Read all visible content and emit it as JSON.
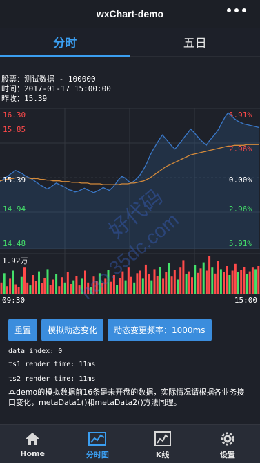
{
  "navbar": {
    "title": "wxChart-demo",
    "more_icon": "more-dots-icon"
  },
  "tabs": [
    {
      "label": "分时",
      "active": true
    },
    {
      "label": "五日",
      "active": false
    }
  ],
  "stock_info": {
    "name_line": "股票：测试数据 - 100000",
    "time_line": "时间：2017-01-17 15:00:00",
    "prev_close_line": "昨收：15.39"
  },
  "chart_data": {
    "type": "line",
    "price_labels": [
      "16.30",
      "15.85",
      "15.39",
      "14.94",
      "14.48"
    ],
    "percent_labels": [
      "5.91%",
      "2.96%",
      "0.00%",
      "2.96%",
      "5.91%"
    ],
    "ylim": [
      14.48,
      16.3
    ],
    "prev_close": 15.39,
    "volume_max_label": "1.92万",
    "x_labels": [
      "09:30",
      "15:00"
    ],
    "colors": {
      "up": "#ff4a4a",
      "down": "#44e06a",
      "price_line": "#3a78c8",
      "avg_line": "#d48a3a"
    },
    "price_series": [
      15.35,
      15.38,
      15.41,
      15.44,
      15.47,
      15.5,
      15.48,
      15.46,
      15.43,
      15.41,
      15.39,
      15.36,
      15.33,
      15.3,
      15.28,
      15.25,
      15.27,
      15.3,
      15.33,
      15.31,
      15.29,
      15.27,
      15.24,
      15.23,
      15.21,
      15.22,
      15.24,
      15.26,
      15.24,
      15.22,
      15.2,
      15.22,
      15.24,
      15.27,
      15.25,
      15.23,
      15.27,
      15.32,
      15.38,
      15.42,
      15.4,
      15.36,
      15.33,
      15.36,
      15.4,
      15.45,
      15.52,
      15.6,
      15.7,
      15.78,
      15.85,
      15.92,
      15.98,
      15.93,
      15.88,
      15.83,
      15.79,
      15.84,
      15.89,
      15.95,
      16.0,
      16.06,
      16.02,
      15.97,
      15.92,
      15.88,
      15.84,
      15.9,
      15.95,
      16.0,
      16.06,
      16.14,
      16.22,
      16.28,
      16.24,
      16.2,
      16.17,
      16.15,
      16.13,
      16.12,
      16.11,
      16.1,
      16.09,
      16.08
    ],
    "avg_series": [
      15.36,
      15.37,
      15.38,
      15.39,
      15.39,
      15.4,
      15.4,
      15.4,
      15.4,
      15.4,
      15.39,
      15.39,
      15.39,
      15.38,
      15.38,
      15.37,
      15.37,
      15.36,
      15.36,
      15.36,
      15.35,
      15.35,
      15.35,
      15.34,
      15.34,
      15.34,
      15.33,
      15.33,
      15.33,
      15.32,
      15.32,
      15.32,
      15.32,
      15.31,
      15.31,
      15.31,
      15.31,
      15.31,
      15.31,
      15.32,
      15.32,
      15.32,
      15.33,
      15.33,
      15.34,
      15.35,
      15.36,
      15.38,
      15.4,
      15.43,
      15.46,
      15.49,
      15.52,
      15.55,
      15.57,
      15.59,
      15.61,
      15.63,
      15.65,
      15.67,
      15.69,
      15.71,
      15.72,
      15.73,
      15.74,
      15.75,
      15.76,
      15.77,
      15.78,
      15.79,
      15.8,
      15.81,
      15.82,
      15.83,
      15.83,
      15.84,
      15.84,
      15.84,
      15.84,
      15.85,
      15.85,
      15.85,
      15.85,
      15.85
    ],
    "volumes": [
      0.3,
      0.55,
      0.2,
      0.4,
      0.62,
      0.25,
      0.18,
      0.45,
      0.7,
      0.3,
      0.22,
      0.5,
      0.35,
      0.6,
      0.28,
      0.42,
      0.66,
      0.24,
      0.38,
      0.52,
      0.2,
      0.44,
      0.3,
      0.58,
      0.26,
      0.36,
      0.48,
      0.22,
      0.4,
      0.62,
      0.3,
      0.18,
      0.46,
      0.34,
      0.55,
      0.28,
      0.4,
      0.64,
      0.32,
      0.5,
      0.24,
      0.42,
      0.6,
      0.36,
      0.7,
      0.45,
      0.3,
      0.55,
      0.62,
      0.4,
      0.78,
      0.52,
      0.36,
      0.66,
      0.48,
      0.72,
      0.4,
      0.58,
      0.82,
      0.46,
      0.64,
      0.38,
      0.7,
      0.9,
      0.52,
      0.6,
      0.44,
      0.76,
      0.56,
      0.68,
      0.84,
      0.62,
      1.0,
      0.7,
      0.54,
      0.88,
      0.66,
      0.58,
      0.74,
      0.5,
      0.62,
      0.8,
      0.58,
      0.64,
      0.72,
      0.52,
      0.6,
      0.7,
      0.66,
      0.74
    ]
  },
  "buttons": {
    "reset": "重置",
    "simulate": "模拟动态变化",
    "frequency": "动态变更频率：1000ms"
  },
  "debug": {
    "data_index": "data index: 0",
    "ts1": "ts1 render time: 11ms",
    "ts2": "ts2 render time: 11ms"
  },
  "description": "本demo的模拟数据前16条是未开盘的数据，实际情况请根据各业务接口变化，metaData1()和metaData2()方法同理。",
  "watermark": {
    "line1": "好代码",
    "line2": "hao.35dc.com"
  },
  "tabbar": [
    {
      "label": "Home",
      "icon": "home-icon",
      "active": false
    },
    {
      "label": "分时图",
      "icon": "timeshare-chart-icon",
      "active": true
    },
    {
      "label": "K线",
      "icon": "kline-chart-icon",
      "active": false
    },
    {
      "label": "设置",
      "icon": "settings-gear-icon",
      "active": false
    }
  ]
}
